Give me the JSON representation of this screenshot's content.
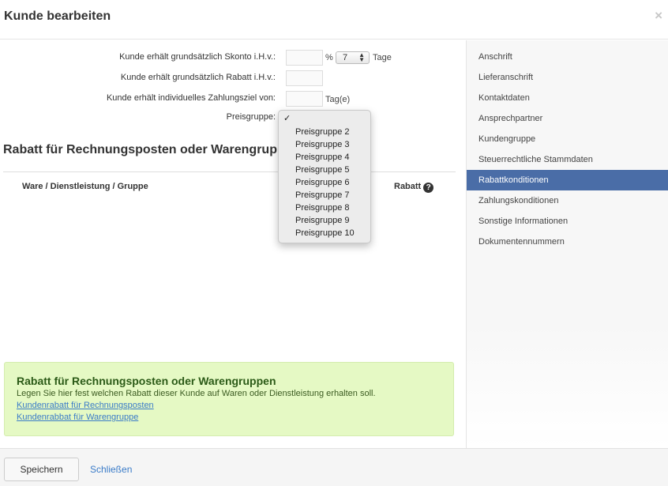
{
  "modal": {
    "title": "Kunde bearbeiten",
    "close_symbol": "×"
  },
  "form": {
    "skonto_label": "Kunde erhält grundsätzlich Skonto i.H.v.:",
    "skonto_value": "",
    "skonto_unit": "%",
    "skonto_days_value": "7",
    "skonto_days_unit": "Tage",
    "rabatt_label": "Kunde erhält grundsätzlich Rabatt i.H.v.:",
    "rabatt_value": "",
    "zahlungsziel_label": "Kunde erhält individuelles Zahlungsziel von:",
    "zahlungsziel_value": "",
    "zahlungsziel_unit": "Tag(e)",
    "preisgruppe_label": "Preisgruppe:"
  },
  "preisgruppe_dropdown": {
    "selected_mark": "✓",
    "options": [
      "Preisgruppe 2",
      "Preisgruppe 3",
      "Preisgruppe 4",
      "Preisgruppe 5",
      "Preisgruppe 6",
      "Preisgruppe 7",
      "Preisgruppe 8",
      "Preisgruppe 9",
      "Preisgruppe 10"
    ]
  },
  "section": {
    "title": "Rabatt für Rechnungsposten oder Warengruppen",
    "col_item": "Ware / Dienstleistung / Gruppe",
    "col_rabatt": "Rabatt",
    "help_icon": "question-circle-icon"
  },
  "info_box": {
    "title": "Rabatt für Rechnungsposten oder Warengruppen",
    "text": "Legen Sie hier fest welchen Rabatt dieser Kunde auf Waren oder Dienstleistung erhalten soll.",
    "link1": "Kundenrabatt für Rechnungsposten",
    "link2": "Kundenrabbat für Warengruppe",
    "bg_color": "#e5f9c4"
  },
  "sidebar": {
    "active_color": "#4a6da7",
    "active_index": 6,
    "items": [
      {
        "label": "Anschrift"
      },
      {
        "label": "Lieferanschrift"
      },
      {
        "label": "Kontaktdaten"
      },
      {
        "label": "Ansprechpartner"
      },
      {
        "label": "Kundengruppe"
      },
      {
        "label": "Steuerrechtliche Stammdaten"
      },
      {
        "label": "Rabattkonditionen"
      },
      {
        "label": "Zahlungskonditionen"
      },
      {
        "label": "Sonstige Informationen"
      },
      {
        "label": "Dokumentennummern"
      }
    ]
  },
  "footer": {
    "save_label": "Speichern",
    "close_label": "Schließen"
  }
}
